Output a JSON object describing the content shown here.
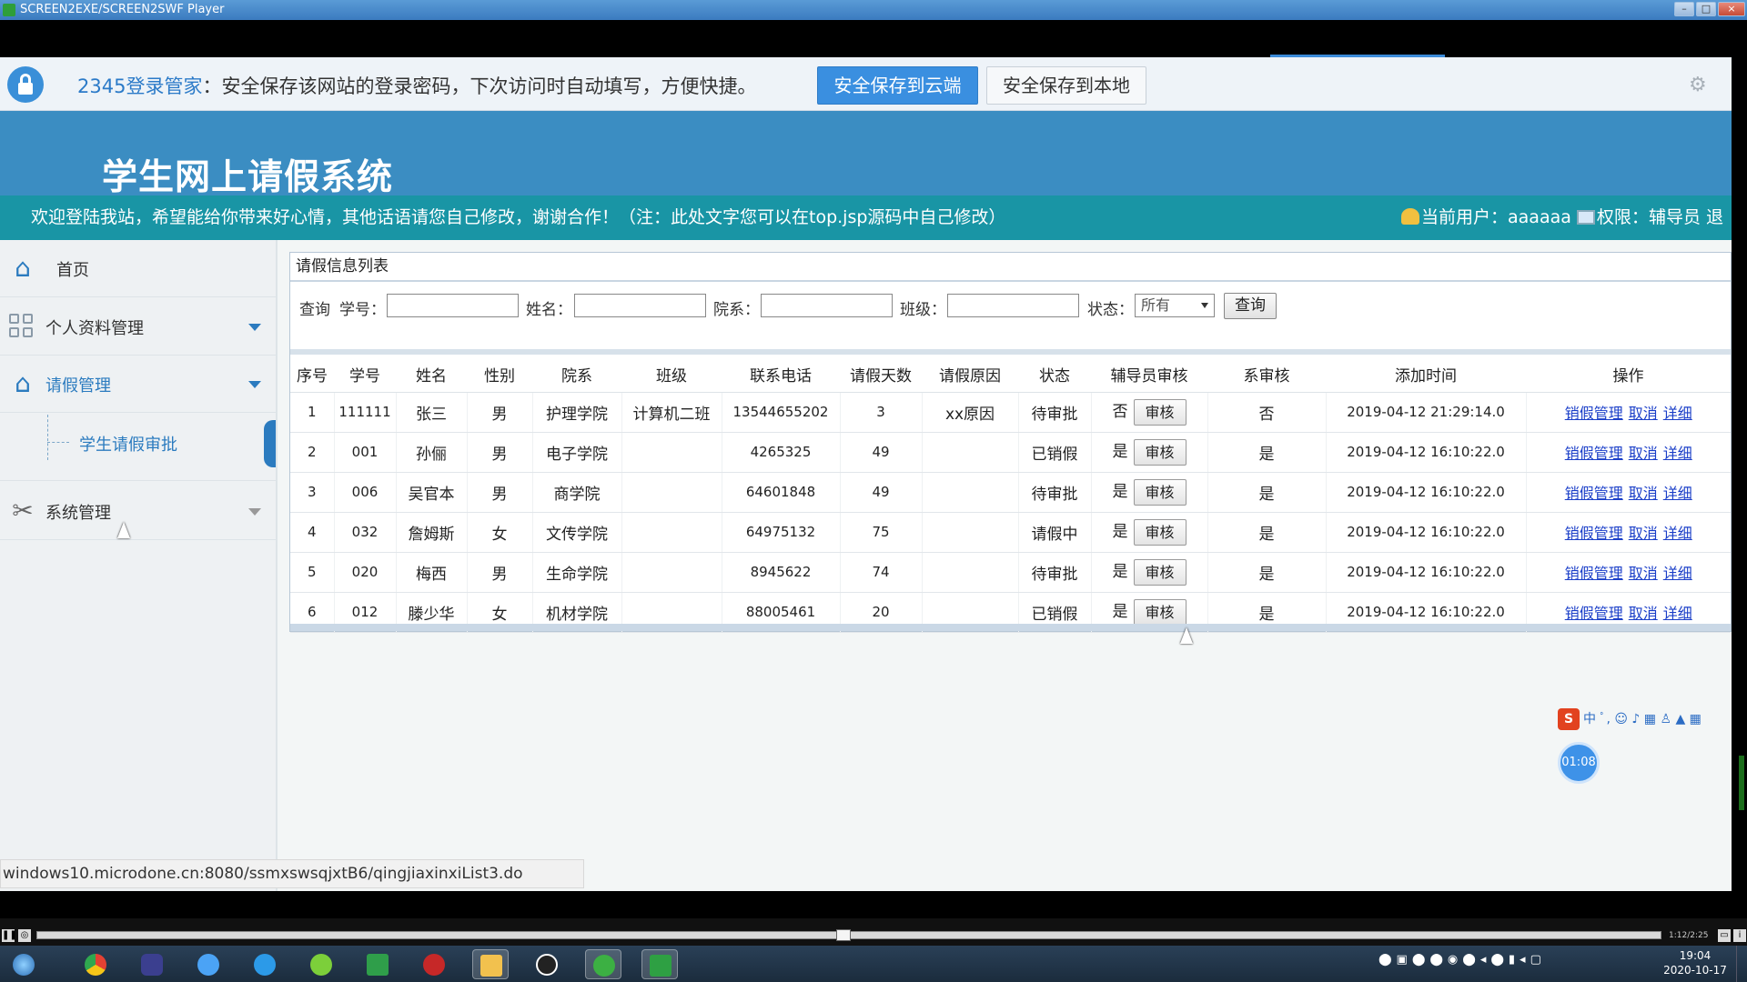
{
  "window": {
    "title": "SCREEN2EXE/SCREEN2SWF Player",
    "controls": [
      "–",
      "□",
      "×"
    ]
  },
  "password_bar": {
    "brand": "2345登录管家",
    "message": "：安全保存该网站的登录密码，下次访问时自动填写，方便快捷。",
    "save_cloud": "安全保存到云端",
    "save_local": "安全保存到本地",
    "icon": "gear-icon"
  },
  "header": {
    "title": "学生网上请假系统",
    "welcome": "欢迎登陆我站，希望能给你带来好心情，其他话语请您自己修改，谢谢合作！（注：此处文字您可以在top.jsp源码中自己修改）",
    "current_user_label": "当前用户：",
    "current_user": "aaaaaa",
    "role_label": "权限：",
    "role": "辅导员",
    "logout_partial": "退"
  },
  "sidebar": {
    "home": "首页",
    "profile": "个人资料管理",
    "leave": "请假管理",
    "leave_sub": "学生请假审批",
    "system": "系统管理"
  },
  "panel": {
    "title": "请假信息列表",
    "search": {
      "prefix": "查询",
      "student_id": "学号：",
      "name": "姓名：",
      "department": "院系：",
      "class": "班级：",
      "status": "状态：",
      "status_value": "所有",
      "query_button": "查询"
    },
    "columns": [
      "序号",
      "学号",
      "姓名",
      "性别",
      "院系",
      "班级",
      "联系电话",
      "请假天数",
      "请假原因",
      "状态",
      "辅导员审核",
      "系审核",
      "添加时间",
      "操作"
    ],
    "audit_button": "审核",
    "actions": [
      "销假管理",
      "取消",
      "详细"
    ],
    "rows": [
      {
        "no": "1",
        "sid": "111111",
        "name": "张三",
        "gender": "男",
        "dept": "护理学院",
        "cls": "计算机二班",
        "phone": "13544655202",
        "days": "3",
        "reason": "xx原因",
        "status": "待审批",
        "counselor": "否",
        "dept_audit": "否",
        "time": "2019-04-12 21:29:14.0"
      },
      {
        "no": "2",
        "sid": "001",
        "name": "孙俪",
        "gender": "男",
        "dept": "电子学院",
        "cls": "",
        "phone": "4265325",
        "days": "49",
        "reason": "",
        "status": "已销假",
        "counselor": "是",
        "dept_audit": "是",
        "time": "2019-04-12 16:10:22.0"
      },
      {
        "no": "3",
        "sid": "006",
        "name": "吴官本",
        "gender": "男",
        "dept": "商学院",
        "cls": "",
        "phone": "64601848",
        "days": "49",
        "reason": "",
        "status": "待审批",
        "counselor": "是",
        "dept_audit": "是",
        "time": "2019-04-12 16:10:22.0"
      },
      {
        "no": "4",
        "sid": "032",
        "name": "詹姆斯",
        "gender": "女",
        "dept": "文传学院",
        "cls": "",
        "phone": "64975132",
        "days": "75",
        "reason": "",
        "status": "请假中",
        "counselor": "是",
        "dept_audit": "是",
        "time": "2019-04-12 16:10:22.0"
      },
      {
        "no": "5",
        "sid": "020",
        "name": "梅西",
        "gender": "男",
        "dept": "生命学院",
        "cls": "",
        "phone": "8945622",
        "days": "74",
        "reason": "",
        "status": "待审批",
        "counselor": "是",
        "dept_audit": "是",
        "time": "2019-04-12 16:10:22.0"
      },
      {
        "no": "6",
        "sid": "012",
        "name": "滕少华",
        "gender": "女",
        "dept": "机材学院",
        "cls": "",
        "phone": "88005461",
        "days": "20",
        "reason": "",
        "status": "已销假",
        "counselor": "是",
        "dept_audit": "是",
        "time": "2019-04-12 16:10:22.0"
      }
    ]
  },
  "status_url": "windows10.microdone.cn:8080/ssmxswsqjxtB6/qingjiaxinxiList3.do",
  "ime": {
    "logo": "S",
    "mode": "中",
    "icons": "ﾟ, ☺ ♪ ▦ ♙ ▲ ▦"
  },
  "timer": "01:08",
  "player": {
    "time": "1:12/2:25"
  },
  "clock": {
    "time": "19:04",
    "date": "2020-10-17"
  },
  "colors": {
    "header": "#3b8dc2",
    "welcome": "#1995a5",
    "accent": "#2b7bbf",
    "link": "#1a3ec8"
  }
}
